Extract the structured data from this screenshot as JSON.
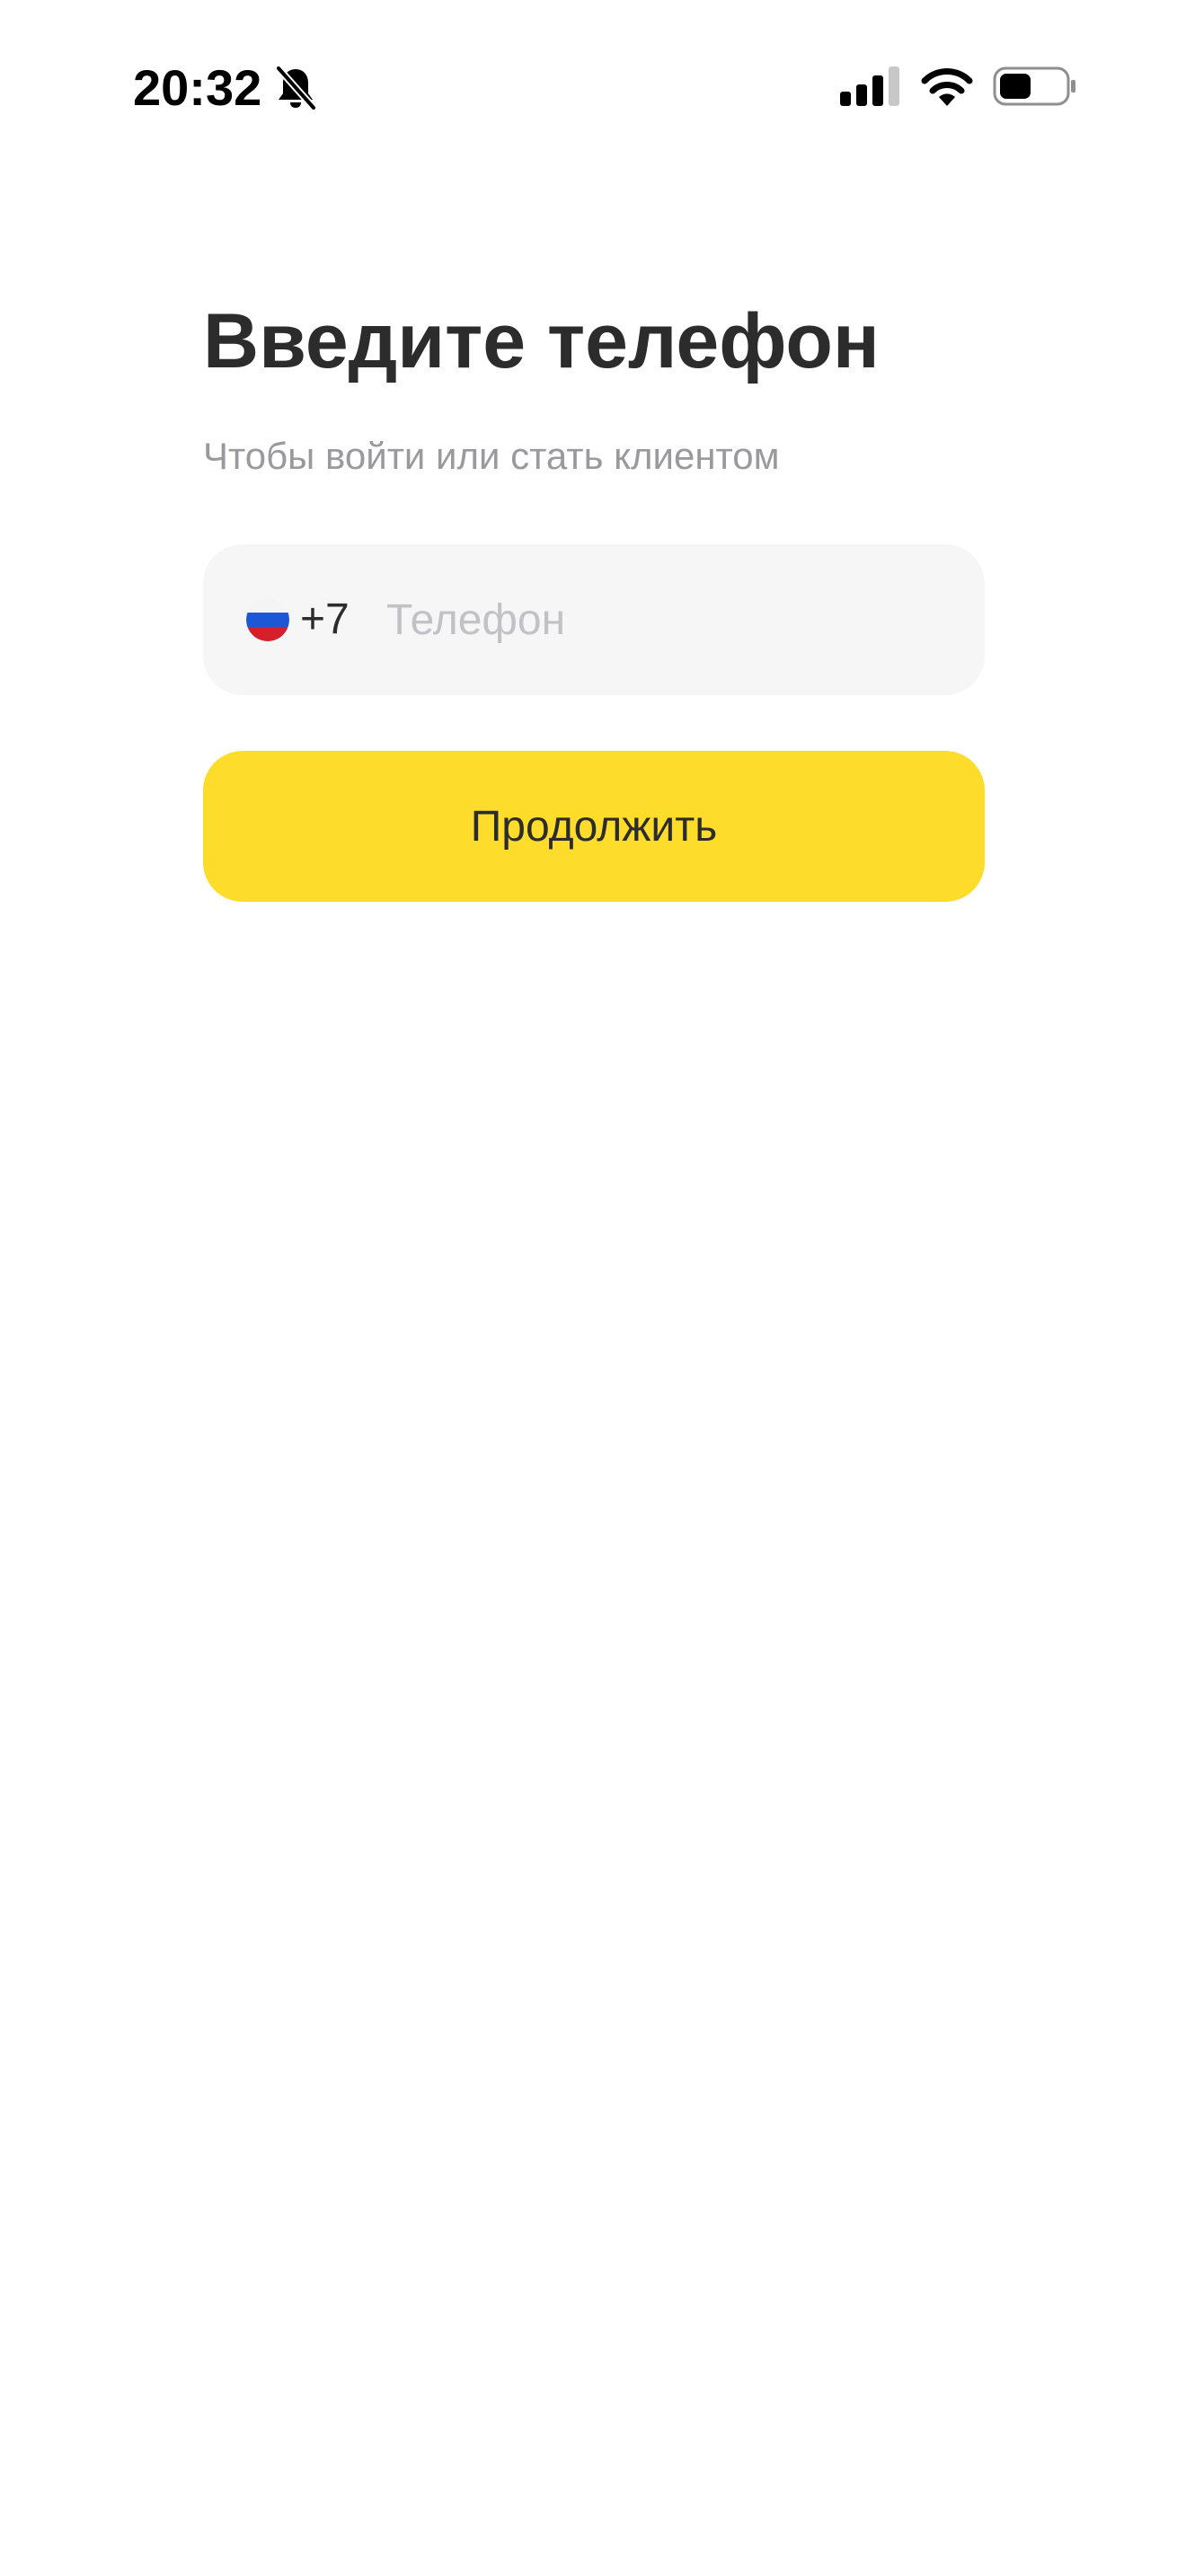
{
  "status_bar": {
    "time": "20:32",
    "icons": [
      "bell-slash-icon",
      "signal-icon",
      "wifi-icon",
      "battery-icon"
    ]
  },
  "login": {
    "title": "Введите телефон",
    "subtitle": "Чтобы войти или стать клиентом",
    "country_flag": "russia-flag-icon",
    "country_code": "+7",
    "phone_value": "",
    "phone_placeholder": "Телефон",
    "continue_label": "Продолжить"
  },
  "colors": {
    "accent": "#fedc2c",
    "field_background": "#f6f6f6",
    "title_text": "#2c2c2c",
    "subtitle_text": "#9a9a9e",
    "placeholder_text": "#c2c2c6"
  }
}
